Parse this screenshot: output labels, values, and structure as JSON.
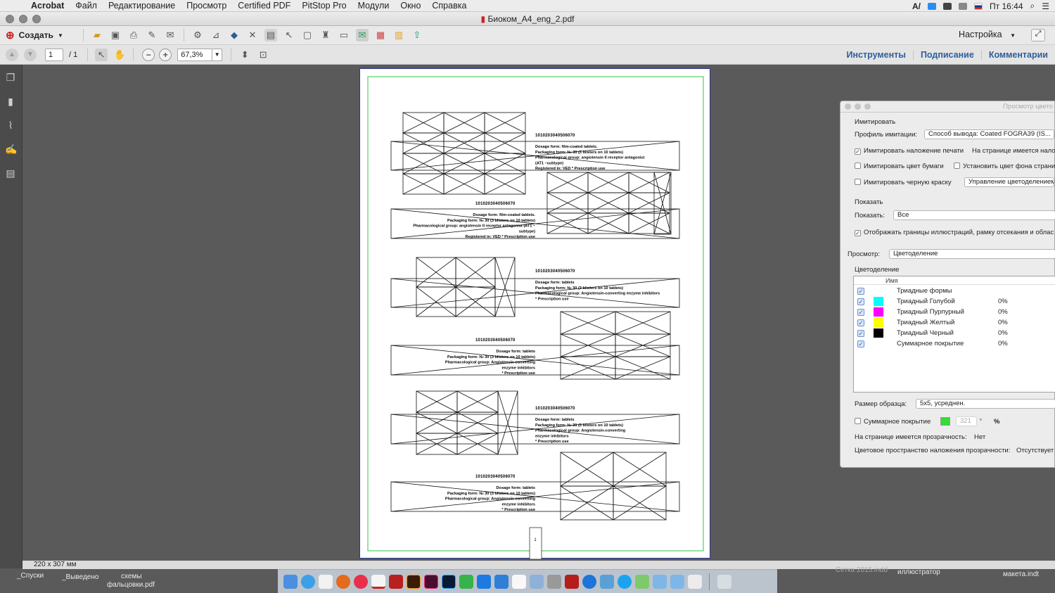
{
  "menubar": {
    "app_name": "Acrobat",
    "items": [
      "Файл",
      "Редактирование",
      "Просмотр",
      "Certified PDF",
      "PitStop Pro",
      "Модули",
      "Окно",
      "Справка"
    ],
    "clock": "Пт 16:44"
  },
  "window": {
    "title": "Биоком_A4_eng_2.pdf"
  },
  "toolbar": {
    "create_label": "Создать",
    "settings_label": "Настройка",
    "page_current": "1",
    "page_total": "/ 1",
    "zoom_value": "67,3%"
  },
  "panels": {
    "tools": "Инструменты",
    "sign": "Подписание",
    "comments": "Комментарии"
  },
  "statusbar": {
    "dimensions": "220 x 307 мм"
  },
  "desktop": {
    "item1": "_Спуски",
    "item2": "_Выведено",
    "item3_line1": "схемы",
    "item3_line2": "фальцовки.pdf",
    "item4": "Сетка 2015.indd",
    "item5": "иллюстратор",
    "item6": "макета.indt"
  },
  "document": {
    "blocks": [
      {
        "code": "1010203040506070",
        "lines": [
          "Dosage form: film-coated tablets.",
          "Packaging form: № 30 (3 blisters on 10 tablets)",
          "Pharmacological group: angiotensin II receptor antagonist",
          "(AT1 –subtype)",
          "Registered in: VED * Prescription use"
        ]
      },
      {
        "code": "1010203040506070",
        "lines": [
          "Dosage form: film-coated tablets.",
          "Packaging form: № 30 (3 blisters on 10 tablets)",
          "Pharmacological group: angiotensin II receptor antagonist (AT1 –",
          "subtype)",
          "Registered in: VED * Prescription use"
        ]
      },
      {
        "code": "1010203040506070",
        "lines": [
          "Dosage form: tablets",
          "Packaging form: № 30 (3 blisters on 10 tablets)",
          "Pharmacological group: Angiotensin-converting enzyme inhibitors",
          "* Prescription use"
        ]
      },
      {
        "code": "1010203040506070",
        "lines": [
          "Dosage form: tablets",
          "Packaging form: № 30 (3 blisters on 10 tablets)",
          "Pharmacological group: Angiotensin-converting",
          "enzyme inhibitors",
          "* Prescription use"
        ]
      },
      {
        "code": "1010203040506070",
        "lines": [
          "Dosage form: tablets",
          "Packaging form: № 30 (3 blisters on 10 tablets)",
          "Pharmacological group: Angiotensin-converting",
          "enzyme inhibitors",
          "* Prescription use"
        ]
      },
      {
        "code": "1010203040506070",
        "lines": [
          "Dosage form: tablets",
          "Packaging form: № 30 (3 blisters on 10 tablets)",
          "Pharmacological group: Angiotensin-converting",
          "enzyme inhibitors",
          "* Prescription use"
        ]
      }
    ],
    "page_number": "1"
  },
  "color_panel": {
    "title": "Просмотр цвето",
    "simulate_heading": "Имитировать",
    "profile_label": "Профиль имитации:",
    "profile_value": "Способ вывода: Coated FOGRA39 (IS...",
    "overprint_label": "Имитировать наложение печати",
    "overprint_checked": true,
    "page_has_overprint": "На странице имеется налож",
    "paper_color_label": "Имитировать цвет бумаги",
    "page_bg_label": "Установить цвет фона страни",
    "black_ink_label": "Имитировать черную краску",
    "color_mgmt_button": "Управление цветоделением",
    "show_heading": "Показать",
    "show_label": "Показать:",
    "show_value": "Все",
    "show_boxes_label": "Отображать границы иллюстраций, рамку отсекания и облас",
    "show_boxes_checked": true,
    "preview_label": "Просмотр:",
    "preview_value": "Цветоделение",
    "separations_heading": "Цветоделение",
    "col_name": "Имя",
    "separations": [
      {
        "name": "Триадные формы",
        "color": "",
        "percent": ""
      },
      {
        "name": "Триадный Голубой",
        "color": "#00ffff",
        "percent": "0%"
      },
      {
        "name": "Триадный Пурпурный",
        "color": "#ff00ff",
        "percent": "0%"
      },
      {
        "name": "Триадный Желтый",
        "color": "#ffff00",
        "percent": "0%"
      },
      {
        "name": "Триадный Черный",
        "color": "#000000",
        "percent": "0%"
      },
      {
        "name": "Суммарное покрытие",
        "color": "",
        "percent": "0%"
      }
    ],
    "sample_size_label": "Размер образца:",
    "sample_size_value": "5x5, усреднен.",
    "total_coverage_label": "Суммарное покрытие",
    "total_coverage_value": "321",
    "total_coverage_swatch": "#33dd33",
    "percent_sign": "%",
    "transparency_label": "На странице имеется прозрачность:",
    "transparency_value": "Нет",
    "blend_space_label": "Цветовое пространство наложения прозрачности:",
    "blend_space_value": "Отсутствует"
  }
}
